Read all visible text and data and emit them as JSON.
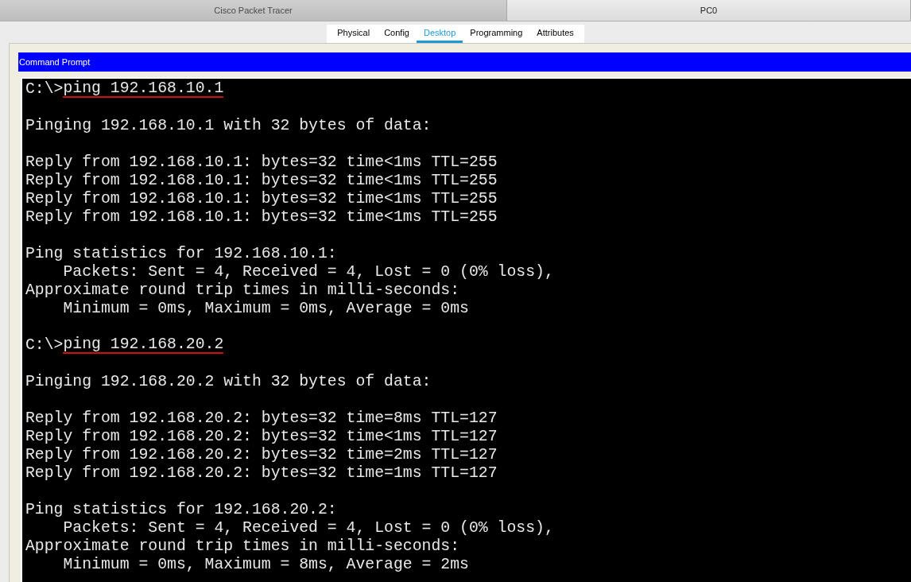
{
  "window": {
    "titles": [
      "Cisco Packet Tracer",
      "PC0"
    ]
  },
  "tabs": [
    {
      "label": "Physical",
      "selected": false
    },
    {
      "label": "Config",
      "selected": false
    },
    {
      "label": "Desktop",
      "selected": true
    },
    {
      "label": "Programming",
      "selected": false
    },
    {
      "label": "Attributes",
      "selected": false
    }
  ],
  "panel": {
    "title": "Command Prompt"
  },
  "terminal": {
    "blocks": [
      [
        {
          "kind": "command",
          "prompt": "C:\\>",
          "text": "ping 192.168.10.1",
          "underlined": true
        }
      ],
      [
        {
          "kind": "output",
          "text": "Pinging 192.168.10.1 with 32 bytes of data:"
        }
      ],
      [
        {
          "kind": "output",
          "text": "Reply from 192.168.10.1: bytes=32 time<1ms TTL=255"
        },
        {
          "kind": "output",
          "text": "Reply from 192.168.10.1: bytes=32 time<1ms TTL=255"
        },
        {
          "kind": "output",
          "text": "Reply from 192.168.10.1: bytes=32 time<1ms TTL=255"
        },
        {
          "kind": "output",
          "text": "Reply from 192.168.10.1: bytes=32 time<1ms TTL=255"
        }
      ],
      [
        {
          "kind": "output",
          "text": "Ping statistics for 192.168.10.1:"
        },
        {
          "kind": "output",
          "text": "    Packets: Sent = 4, Received = 4, Lost = 0 (0% loss),"
        },
        {
          "kind": "output",
          "text": "Approximate round trip times in milli-seconds:"
        },
        {
          "kind": "output",
          "text": "    Minimum = 0ms, Maximum = 0ms, Average = 0ms"
        }
      ],
      [
        {
          "kind": "command",
          "prompt": "C:\\>",
          "text": "ping 192.168.20.2",
          "underlined": true
        }
      ],
      [
        {
          "kind": "output",
          "text": "Pinging 192.168.20.2 with 32 bytes of data:"
        }
      ],
      [
        {
          "kind": "output",
          "text": "Reply from 192.168.20.2: bytes=32 time=8ms TTL=127"
        },
        {
          "kind": "output",
          "text": "Reply from 192.168.20.2: bytes=32 time<1ms TTL=127"
        },
        {
          "kind": "output",
          "text": "Reply from 192.168.20.2: bytes=32 time=2ms TTL=127"
        },
        {
          "kind": "output",
          "text": "Reply from 192.168.20.2: bytes=32 time=1ms TTL=127"
        }
      ],
      [
        {
          "kind": "output",
          "text": "Ping statistics for 192.168.20.2:"
        },
        {
          "kind": "output",
          "text": "    Packets: Sent = 4, Received = 4, Lost = 0 (0% loss),"
        },
        {
          "kind": "output",
          "text": "Approximate round trip times in milli-seconds:"
        },
        {
          "kind": "output",
          "text": "    Minimum = 0ms, Maximum = 8ms, Average = 2ms"
        }
      ]
    ]
  }
}
